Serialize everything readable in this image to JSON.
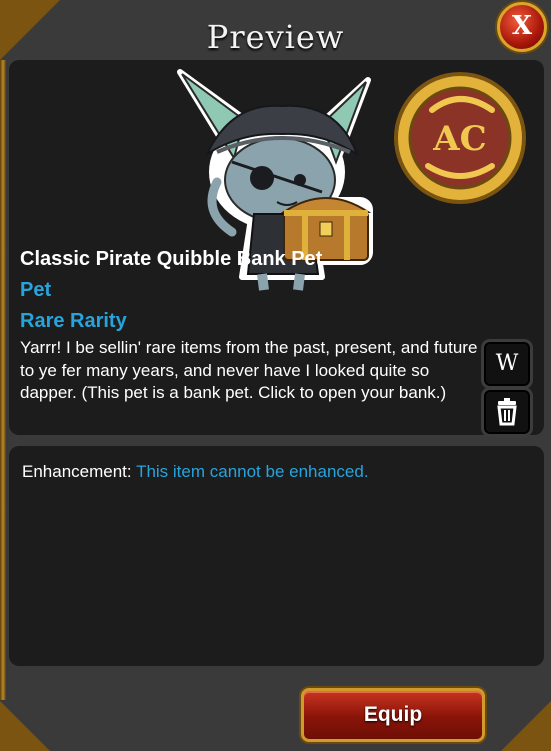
{
  "dialog": {
    "title": "Preview",
    "close_label": "X"
  },
  "item": {
    "name": "Classic Pirate Quibble Bank Pet",
    "type": "Pet",
    "rarity": "Rare Rarity",
    "description": "Yarrr! I be sellin' rare items from the past, present, and future to ye fer many years, and never have I looked quite so dapper. (This pet is a bank pet. Click to open your bank.)",
    "badge_text": "AC"
  },
  "side_buttons": {
    "wiki_label": "W"
  },
  "enhancement": {
    "label": "Enhancement:",
    "value": "This item cannot be enhanced."
  },
  "actions": {
    "equip_label": "Equip"
  },
  "colors": {
    "accent_blue": "#27a4dc",
    "panel": "#1c1c1c",
    "frame_gold": "#d09a2c",
    "button_red": "#8a1409"
  }
}
